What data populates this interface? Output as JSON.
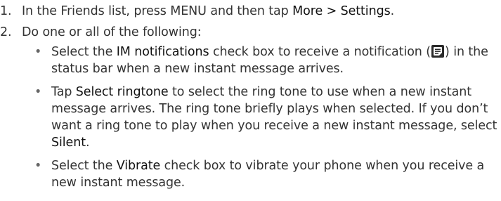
{
  "steps": [
    {
      "number": "1.",
      "text_before": "In the Friends list, press MENU and then tap ",
      "term": "More > Settings",
      "text_after": "."
    },
    {
      "number": "2.",
      "text": "Do one or all of the following:",
      "bullets": [
        {
          "marker": "•",
          "text_before": "Select the ",
          "term": "IM notifications",
          "text_mid": " check box to receive a notification (",
          "icon": "message-notification-icon",
          "text_after": ") in the status bar when a new instant message arrives."
        },
        {
          "marker": "•",
          "text_before": "Tap ",
          "term": "Select ringtone",
          "text_mid": " to select the ring tone to use when a new instant message arrives. The ring tone briefly plays when selected. If you don’t want a ring tone to play when you receive a new instant message, select ",
          "term2": "Silent",
          "text_after": "."
        },
        {
          "marker": "•",
          "text_before": "Select the ",
          "term": "Vibrate",
          "text_after": " check box to vibrate your phone when you receive a new instant message."
        }
      ]
    }
  ]
}
